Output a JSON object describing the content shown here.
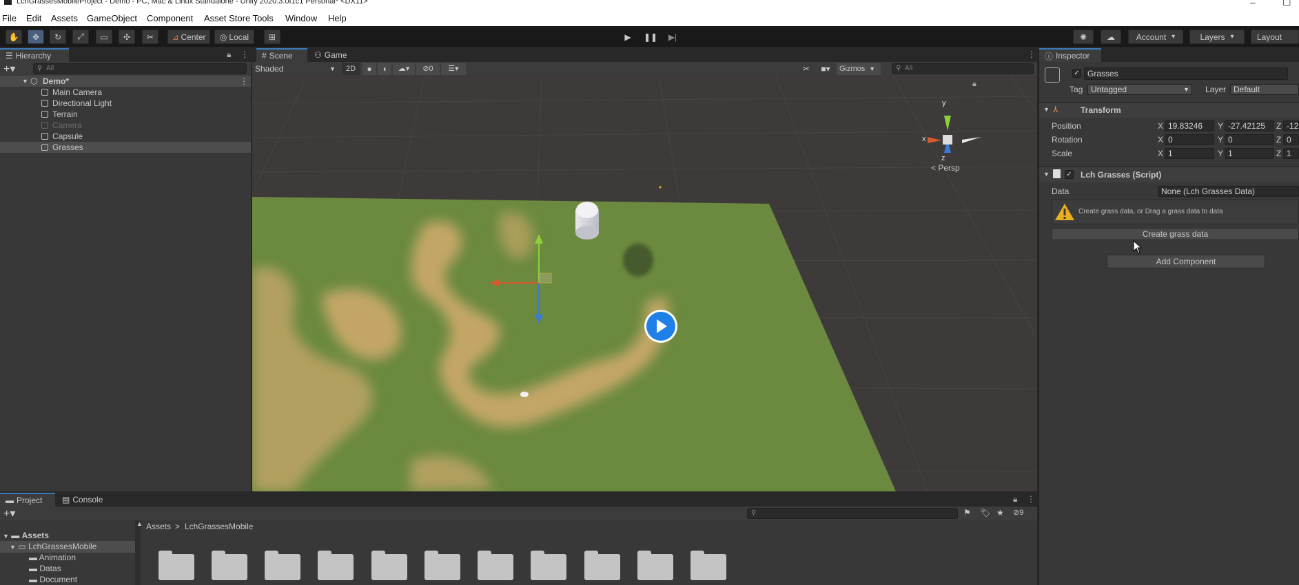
{
  "window": {
    "title": "LchGrassesMobileProject - Demo - PC, Mac & Linux Standalone - Unity 2020.3.0f1c1 Personal* <DX11>",
    "minimize_glyph": "–",
    "maximize_glyph": "☐"
  },
  "menu": [
    "File",
    "Edit",
    "Assets",
    "GameObject",
    "Component",
    "Asset Store Tools",
    "Window",
    "Help"
  ],
  "toolbar": {
    "tools": [
      "hand-tool-icon",
      "move-tool-icon",
      "rotate-tool-icon",
      "scale-tool-icon",
      "rect-tool-icon",
      "transform-tool-icon",
      "custom-tool-icon"
    ],
    "pivot_label": "Center",
    "space_label": "Local",
    "account_label": "Account",
    "layers_label": "Layers",
    "layout_label": "Layout"
  },
  "hierarchy": {
    "tab_label": "Hierarchy",
    "search_placeholder": "All",
    "scene_name": "Demo*",
    "items": [
      "Main Camera",
      "Directional Light",
      "Terrain",
      "Camera",
      "Capsule",
      "Grasses"
    ],
    "disabled_item": "Camera",
    "selected_item": "Grasses"
  },
  "scene_view": {
    "tabs": [
      "Scene",
      "Game"
    ],
    "active_tab": "Scene",
    "shading_mode": "Shaded",
    "mode_2d": "2D",
    "hidden_count": "0",
    "gizmos_label": "Gizmos",
    "search_placeholder": "All",
    "gizmo_axis_y": "y",
    "gizmo_axis_x": "x",
    "gizmo_axis_z": "z",
    "projection_label": "< Persp"
  },
  "inspector": {
    "tab_label": "Inspector",
    "object_name": "Grasses",
    "tag_label": "Tag",
    "tag_value": "Untagged",
    "layer_label": "Layer",
    "layer_value": "Default",
    "transform": {
      "title": "Transform",
      "rows": [
        {
          "label": "Position",
          "x": "19.83246",
          "y": "-27.42125",
          "z": "-12"
        },
        {
          "label": "Rotation",
          "x": "0",
          "y": "0",
          "z": "0"
        },
        {
          "label": "Scale",
          "x": "1",
          "y": "1",
          "z": "1"
        }
      ],
      "axis_x": "X",
      "axis_y": "Y",
      "axis_z": "Z"
    },
    "script": {
      "title": "Lch Grasses (Script)",
      "data_label": "Data",
      "data_value": "None (Lch Grasses Data)",
      "warning_text": "Create grass data, or Drag a grass data to data",
      "create_button": "Create grass data"
    },
    "add_component_label": "Add Component"
  },
  "project": {
    "tabs": [
      "Project",
      "Console"
    ],
    "active_tab": "Project",
    "breadcrumb": [
      "Assets",
      "LchGrassesMobile"
    ],
    "breadcrumb_sep": ">",
    "tree": {
      "root": "Assets",
      "selected": "LchGrassesMobile",
      "children": [
        "Animation",
        "Datas",
        "Document"
      ]
    },
    "hidden_count": "9",
    "folder_count": 11
  },
  "colors": {
    "accent": "#3a79bb",
    "grass": "#6b8a3f",
    "sand": "#c9a86a",
    "warning": "#e8b020"
  }
}
